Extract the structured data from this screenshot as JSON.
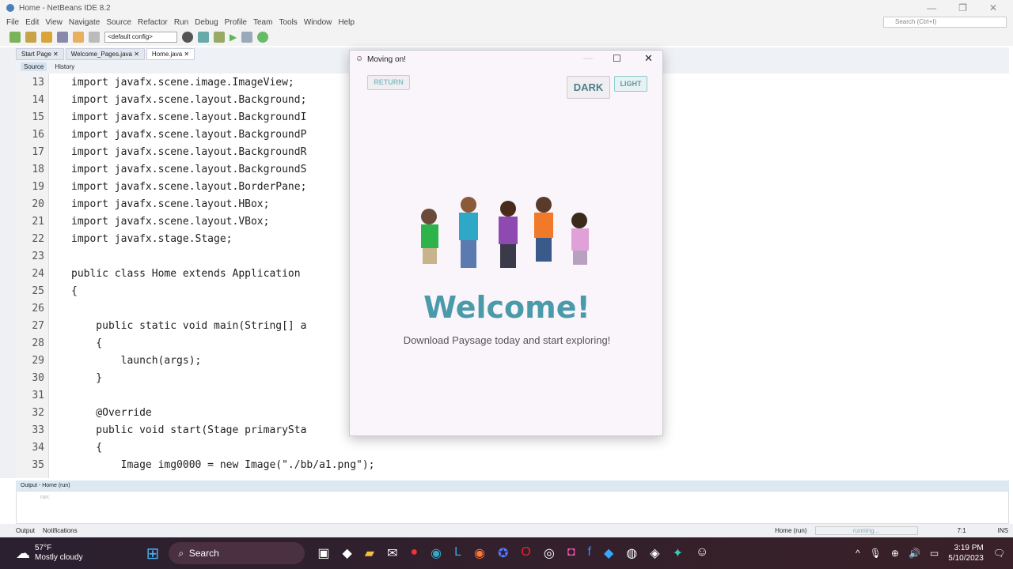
{
  "window": {
    "title": "Home - NetBeans IDE 8.2",
    "search_placeholder": "Search (Ctrl+I)"
  },
  "menu": [
    "File",
    "Edit",
    "View",
    "Navigate",
    "Source",
    "Refactor",
    "Run",
    "Debug",
    "Profile",
    "Team",
    "Tools",
    "Window",
    "Help"
  ],
  "toolbar": {
    "config": "<default config>"
  },
  "tabs": [
    {
      "label": "Start Page"
    },
    {
      "label": "Welcome_Pages.java"
    },
    {
      "label": "Home.java"
    }
  ],
  "editor_tabs": {
    "source": "Source",
    "history": "History"
  },
  "code": [
    {
      "n": "13",
      "t": "import javafx.scene.image.ImageView;"
    },
    {
      "n": "14",
      "t": "import javafx.scene.layout.Background;"
    },
    {
      "n": "15",
      "t": "import javafx.scene.layout.BackgroundI"
    },
    {
      "n": "16",
      "t": "import javafx.scene.layout.BackgroundP"
    },
    {
      "n": "17",
      "t": "import javafx.scene.layout.BackgroundR"
    },
    {
      "n": "18",
      "t": "import javafx.scene.layout.BackgroundS"
    },
    {
      "n": "19",
      "t": "import javafx.scene.layout.BorderPane;"
    },
    {
      "n": "20",
      "t": "import javafx.scene.layout.HBox;"
    },
    {
      "n": "21",
      "t": "import javafx.scene.layout.VBox;"
    },
    {
      "n": "22",
      "t": "import javafx.stage.Stage;"
    },
    {
      "n": "23",
      "t": ""
    },
    {
      "n": "24",
      "t": "public class Home extends Application"
    },
    {
      "n": "25",
      "t": "{"
    },
    {
      "n": "26",
      "t": ""
    },
    {
      "n": "27",
      "t": "    public static void main(String[] a"
    },
    {
      "n": "28",
      "t": "    {"
    },
    {
      "n": "29",
      "t": "        launch(args);"
    },
    {
      "n": "30",
      "t": "    }"
    },
    {
      "n": "31",
      "t": ""
    },
    {
      "n": "32",
      "t": "    @Override"
    },
    {
      "n": "33",
      "t": "    public void start(Stage primarySta"
    },
    {
      "n": "34",
      "t": "    {"
    },
    {
      "n": "35",
      "t": "        Image img0000 = new Image(\"./bb/a1.png\");"
    }
  ],
  "output": {
    "title": "Output - Home (run)",
    "text": "run:"
  },
  "status": {
    "output_tab": "Output",
    "notifications_tab": "Notifications",
    "run_label": "Home (run)",
    "progress": "running...",
    "position": "7:1",
    "mode": "INS"
  },
  "dialog": {
    "title": "Moving on!",
    "return": "RETURN",
    "dark": "DARK",
    "light": "LIGHT",
    "heading": "Welcome!",
    "subtitle": "Download Paysage today and start exploring!"
  },
  "taskbar": {
    "temp": "57°F",
    "weather": "Mostly cloudy",
    "search": "Search",
    "time": "3:19 PM",
    "date": "5/10/2023"
  }
}
